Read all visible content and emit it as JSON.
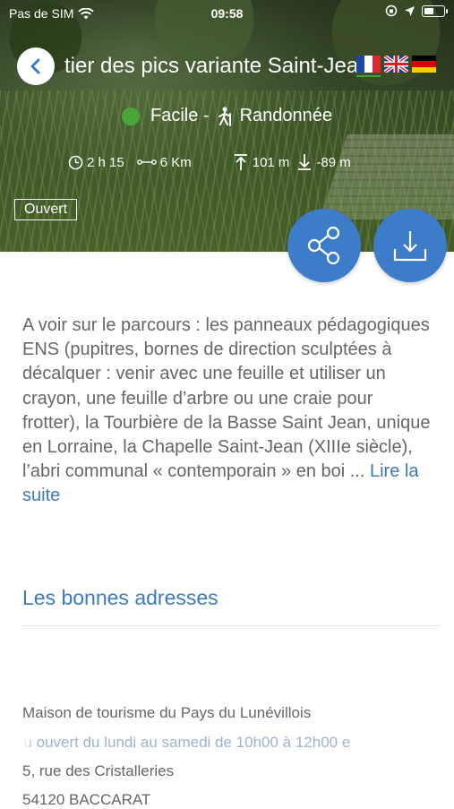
{
  "status_bar": {
    "carrier": "Pas de SIM",
    "time": "09:58"
  },
  "header": {
    "title": "tier des pics variante Saint-Jean",
    "languages": [
      "fr",
      "en",
      "de"
    ],
    "difficulty": "Facile -",
    "activity": "Randonnée",
    "difficulty_color": "#48a53a",
    "duration": "2 h 15",
    "distance": "6 Km",
    "ascent": "101 m",
    "descent": "-89 m",
    "status_badge": "Ouvert"
  },
  "actions": {
    "accent": "#3c7cc9",
    "share_icon": "share-icon",
    "download_icon": "download-icon"
  },
  "description": {
    "text": "A voir sur le parcours : les panneaux pédagogiques ENS (pupitres, bornes de direction sculptées à décalquer : venir avec une feuille et utiliser un crayon, une feuille d’arbre ou une craie pour frotter), la Tourbière de la Basse Saint Jean, unique en Lorraine, la Chapelle Saint-Jean (XIIIe siècle), l’abri communal « contemporain » en boi ... ",
    "read_more": "Lire la suite"
  },
  "addresses": {
    "section_title": "Les bonnes adresses",
    "name": "Maison de tourisme du Pays du Lunévillois",
    "hours": "au ouvert du lundi au samedi de 10h00 à 12h00 e",
    "street": "5, rue des Cristalleries",
    "city": "54120 BACCARAT"
  }
}
